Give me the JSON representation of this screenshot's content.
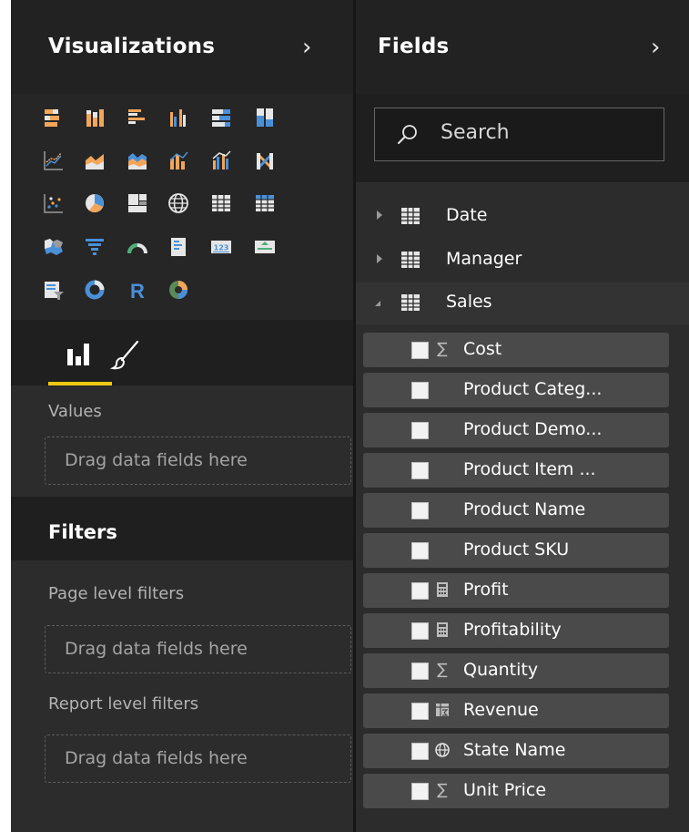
{
  "visualizations": {
    "title": "Visualizations",
    "more": "...",
    "tabs": [
      "fields-tab",
      "format-tab"
    ],
    "values_label": "Values",
    "values_placeholder": "Drag data fields here"
  },
  "filters": {
    "title": "Filters",
    "page_label": "Page level filters",
    "page_placeholder": "Drag data fields here",
    "report_label": "Report level filters",
    "report_placeholder": "Drag data fields here"
  },
  "fields": {
    "title": "Fields",
    "search_placeholder": "Search",
    "tables": [
      {
        "name": "Date",
        "expanded": false
      },
      {
        "name": "Manager",
        "expanded": false
      },
      {
        "name": "Sales",
        "expanded": true
      }
    ],
    "sales_fields": [
      {
        "name": "Cost",
        "type": "sum"
      },
      {
        "name": "Product Categ...",
        "type": "none"
      },
      {
        "name": "Product Demo...",
        "type": "none"
      },
      {
        "name": "Product Item ...",
        "type": "none"
      },
      {
        "name": "Product Name",
        "type": "none"
      },
      {
        "name": "Product SKU",
        "type": "none"
      },
      {
        "name": "Profit",
        "type": "calc"
      },
      {
        "name": "Profitability",
        "type": "calc"
      },
      {
        "name": "Quantity",
        "type": "sum"
      },
      {
        "name": "Revenue",
        "type": "measure"
      },
      {
        "name": "State Name",
        "type": "geo"
      },
      {
        "name": "Unit Price",
        "type": "sum"
      }
    ]
  },
  "colors": {
    "accent": "#f2c811",
    "panel": "#2c2c2c",
    "header": "#222222",
    "field_row": "#4a4a4a",
    "viz_orange": "#f2a65a",
    "viz_blue": "#4a90d9"
  }
}
